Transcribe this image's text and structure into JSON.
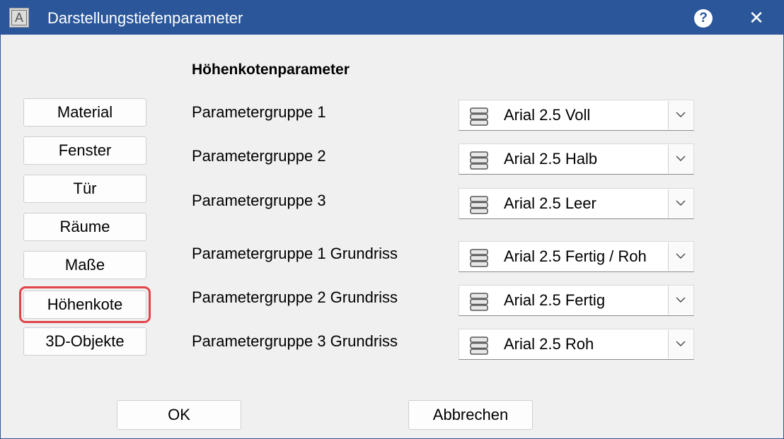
{
  "window": {
    "title": "Darstellungstiefenparameter",
    "help_label": "?",
    "close_label": "✕",
    "app_icon_letter": "A"
  },
  "section_title": "Höhenkotenparameter",
  "nav": {
    "selected": "Höhenkote",
    "items": [
      {
        "label": "Material"
      },
      {
        "label": "Fenster"
      },
      {
        "label": "Tür"
      },
      {
        "label": "Räume"
      },
      {
        "label": "Maße"
      },
      {
        "label": "Höhenkote"
      },
      {
        "label": "3D-Objekte"
      }
    ]
  },
  "params": [
    {
      "label": "Parametergruppe 1",
      "value": "Arial 2.5 Voll"
    },
    {
      "label": "Parametergruppe 2",
      "value": "Arial 2.5 Halb"
    },
    {
      "label": "Parametergruppe 3",
      "value": "Arial 2.5 Leer"
    },
    {
      "label": "Parametergruppe 1 Grundriss",
      "value": "Arial 2.5 Fertig / Roh"
    },
    {
      "label": "Parametergruppe 2 Grundriss",
      "value": "Arial 2.5 Fertig"
    },
    {
      "label": "Parametergruppe 3 Grundriss",
      "value": "Arial 2.5 Roh"
    }
  ],
  "footer": {
    "ok_label": "OK",
    "cancel_label": "Abbrechen"
  },
  "colors": {
    "titlebar": "#2b579a",
    "selected_outline": "#e0454a",
    "background": "#f0f0f0"
  },
  "icons": {
    "combo_item": "stacked-layers-icon",
    "combo_arrow": "chevron-down-icon"
  }
}
